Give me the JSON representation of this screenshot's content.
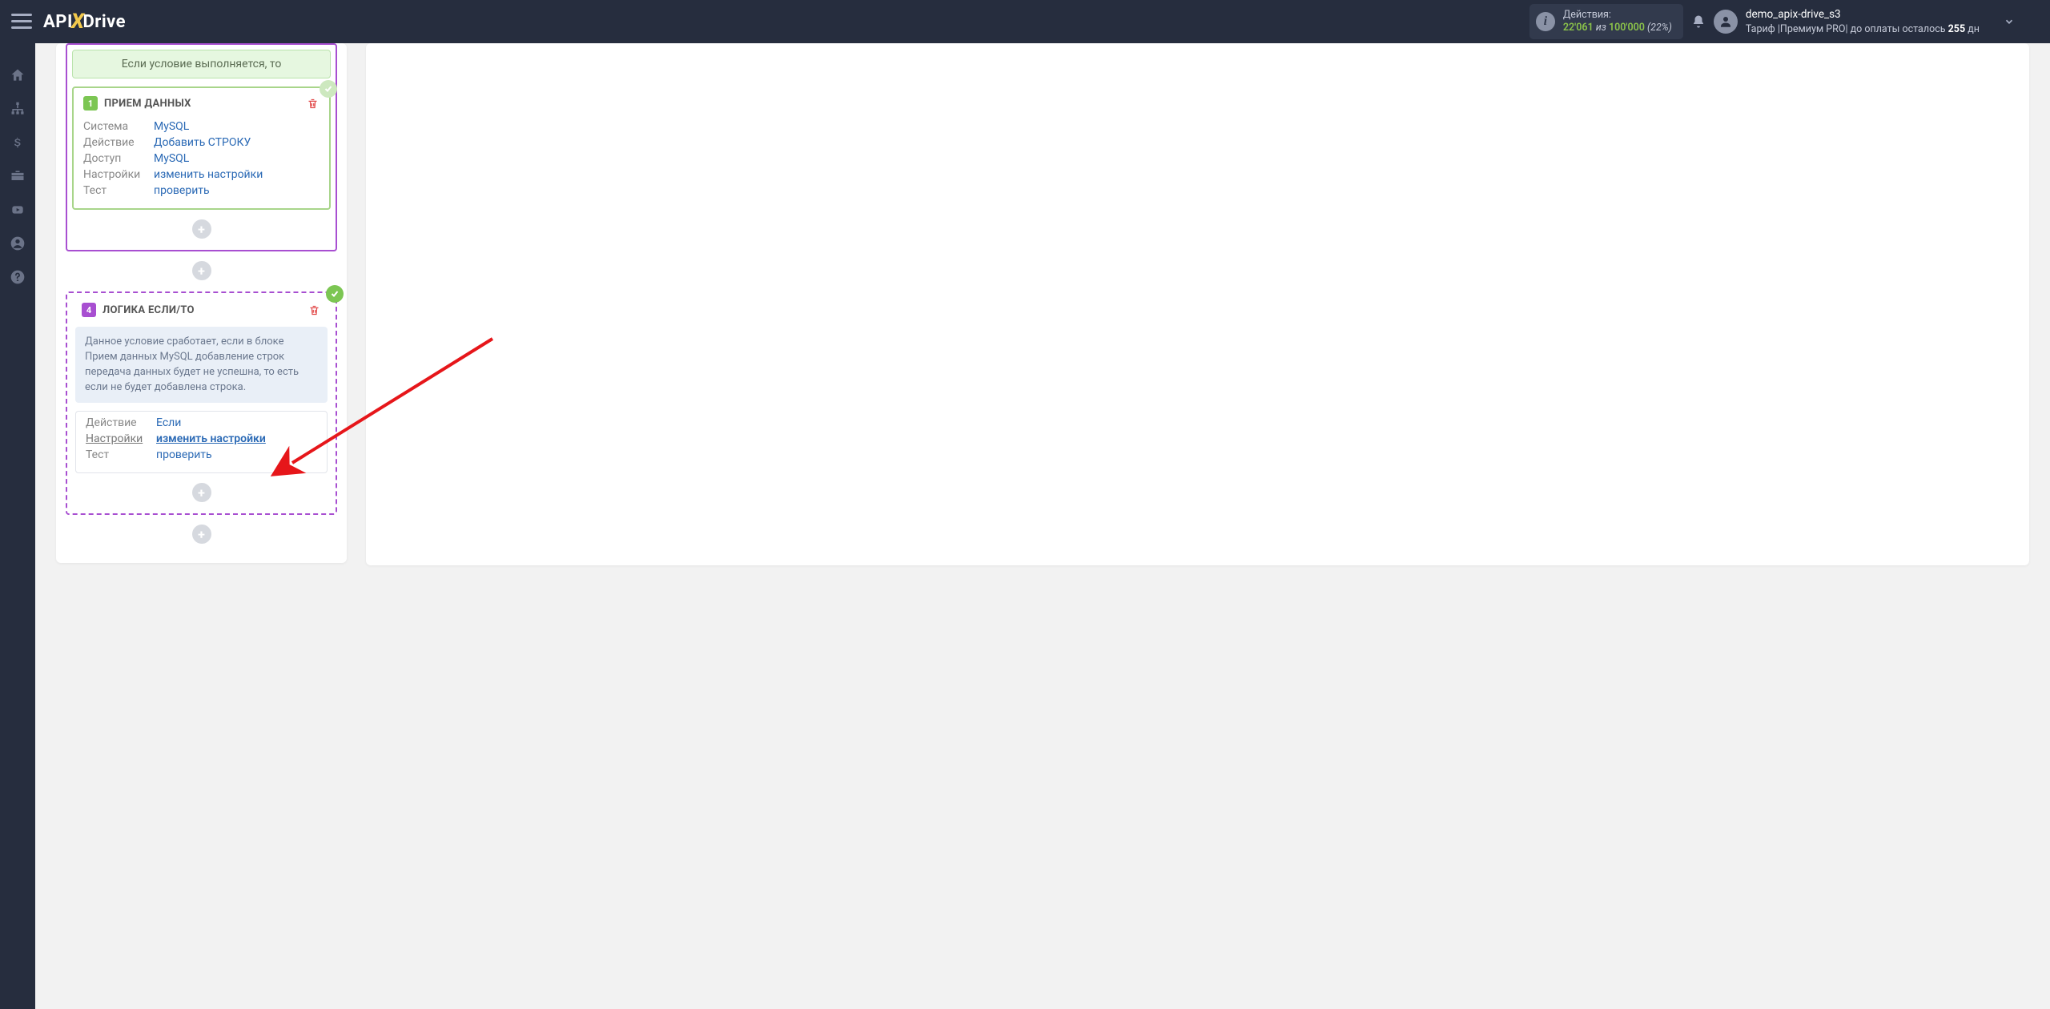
{
  "header": {
    "logo_pre": "API",
    "logo_post": "Drive",
    "actions_label": "Действия:",
    "actions_used": "22'061",
    "actions_sep": " из ",
    "actions_total": "100'000",
    "actions_pct": "(22%)",
    "user_name": "demo_apix-drive_s3",
    "tariff_pre": "Тариф |",
    "tariff_name": "Премиум PRO",
    "tariff_mid": "|  до оплаты осталось ",
    "tariff_days": "255",
    "tariff_suf": " дн"
  },
  "block1": {
    "condition_text": "Если условие выполняется, то",
    "badge": "1",
    "title": "ПРИЕМ ДАННЫХ",
    "rows": {
      "system_l": "Система",
      "system_v": "MySQL",
      "action_l": "Действие",
      "action_v": "Добавить СТРОКУ",
      "access_l": "Доступ",
      "access_v": "MySQL",
      "settings_l": "Настройки",
      "settings_v": "изменить настройки",
      "test_l": "Тест",
      "test_v": "проверить"
    }
  },
  "block2": {
    "badge": "4",
    "title": "ЛОГИКА ЕСЛИ/ТО",
    "info": "Данное условие сработает, если в блоке Прием данных MySQL добавление строк передача данных будет не успешна, то есть если не будет добавлена строка.",
    "rows": {
      "action_l": "Действие",
      "action_v": "Если",
      "settings_l": "Настройки",
      "settings_v": "изменить настройки",
      "test_l": "Тест",
      "test_v": "проверить"
    }
  }
}
